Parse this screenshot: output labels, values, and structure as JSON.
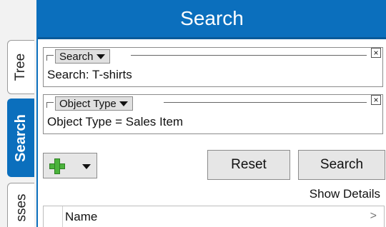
{
  "tabs": [
    {
      "label": "Tree"
    },
    {
      "label": "Search"
    },
    {
      "label": "sses"
    }
  ],
  "header": {
    "title": "Search"
  },
  "criteria": [
    {
      "field": "Search",
      "value": "Search: T-shirts",
      "close": "×"
    },
    {
      "field": "Object Type",
      "value": "Object Type = Sales Item",
      "close": "×"
    }
  ],
  "actions": {
    "reset_label": "Reset",
    "search_label": "Search",
    "show_details_label": "Show Details"
  },
  "results": {
    "columns": [
      "Name"
    ],
    "chevron": ">"
  },
  "colors": {
    "accent": "#0b6fbd",
    "plus": "#4bb33c"
  },
  "icons": {
    "add": "plus-icon",
    "dropdown": "caret-down-icon",
    "close": "close-icon"
  }
}
